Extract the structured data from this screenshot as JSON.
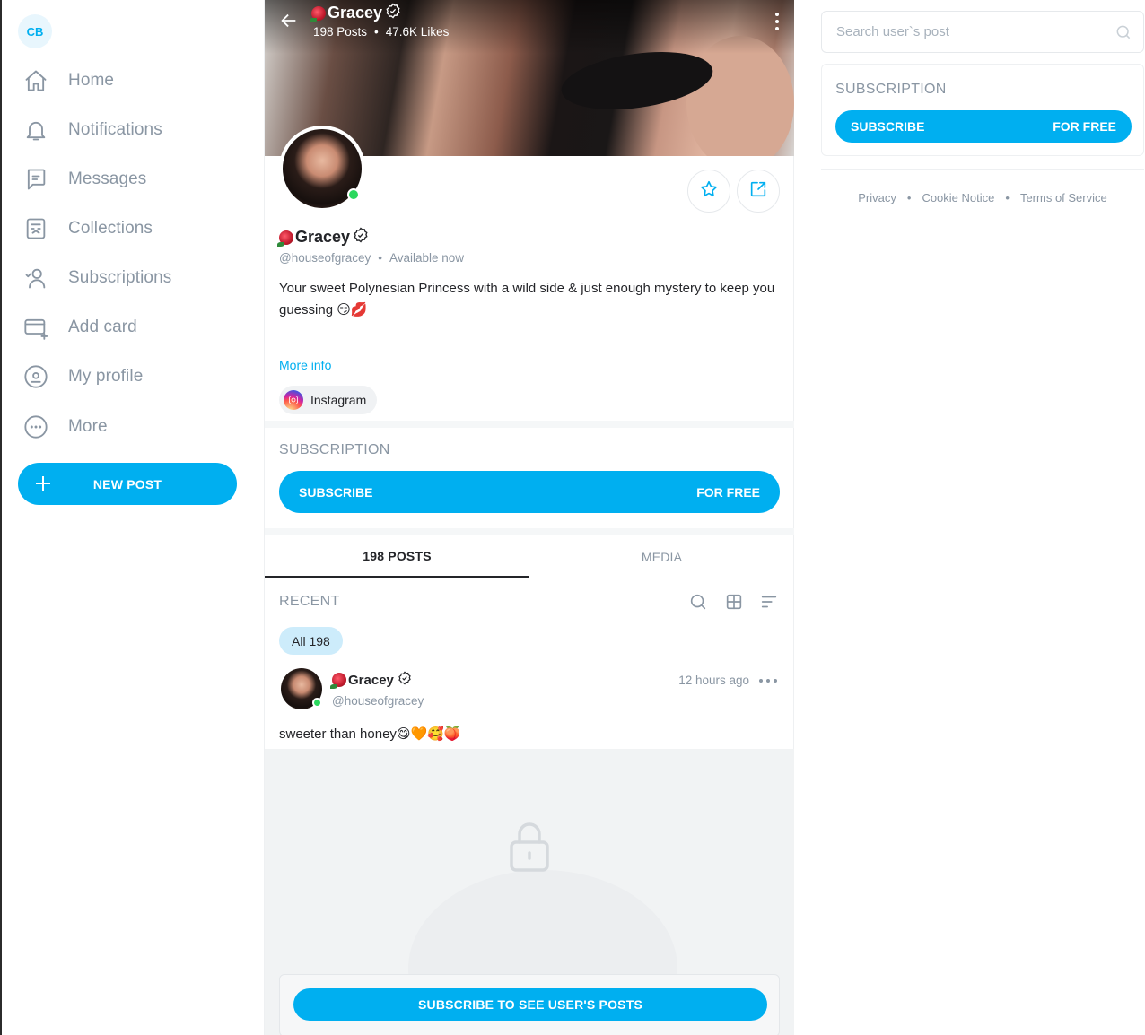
{
  "sidebar": {
    "avatar_initials": "CB",
    "items": [
      {
        "label": "Home",
        "icon": "home-icon"
      },
      {
        "label": "Notifications",
        "icon": "bell-icon"
      },
      {
        "label": "Messages",
        "icon": "message-icon"
      },
      {
        "label": "Collections",
        "icon": "collections-icon"
      },
      {
        "label": "Subscriptions",
        "icon": "subscriptions-icon"
      },
      {
        "label": "Add card",
        "icon": "card-icon"
      },
      {
        "label": "My profile",
        "icon": "profile-icon"
      },
      {
        "label": "More",
        "icon": "more-icon"
      }
    ],
    "new_post_label": "NEW POST"
  },
  "profile": {
    "cover_name": "Gracey",
    "posts_count": "198 Posts",
    "likes_count": "47.6K Likes",
    "name": "Gracey",
    "handle": "@houseofgracey",
    "status": "Available now",
    "bio": "Your sweet Polynesian Princess with a wild side & just enough mystery to keep you guessing 😏💋",
    "more_info": "More info",
    "instagram_label": "Instagram"
  },
  "subscription": {
    "title": "SUBSCRIPTION",
    "button_left": "SUBSCRIBE",
    "button_right": "FOR FREE"
  },
  "tabs": [
    {
      "label": "198 POSTS",
      "active": true
    },
    {
      "label": "MEDIA",
      "active": false
    }
  ],
  "feed": {
    "section_title": "RECENT",
    "filter_chip": "All 198",
    "post": {
      "name": "Gracey",
      "handle": "@houseofgracey",
      "time": "12 hours ago",
      "text": "sweeter than honey😋🧡🥰🍑"
    },
    "locked_button": "SUBSCRIBE TO SEE USER'S POSTS"
  },
  "right": {
    "search_placeholder": "Search user`s post",
    "subscription_title": "SUBSCRIPTION",
    "subscribe_left": "SUBSCRIBE",
    "subscribe_right": "FOR FREE",
    "footer": [
      "Privacy",
      "Cookie Notice",
      "Terms of Service"
    ]
  },
  "colors": {
    "accent": "#00aff0",
    "muted_text": "#8a96a3",
    "online": "#2bd85e",
    "chip_bg": "#cdecfb"
  }
}
